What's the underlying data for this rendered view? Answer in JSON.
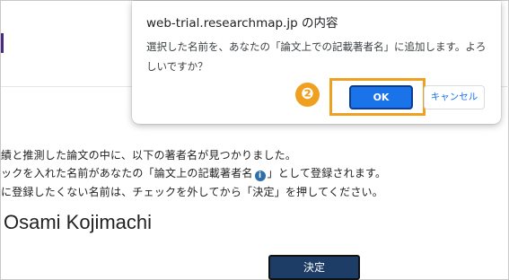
{
  "dialog": {
    "title": "web-trial.researchmap.jp の内容",
    "message": "選択した名前を、あなたの「論文上での記載著者名」に追加します。よろしいですか？",
    "ok_label": "OK",
    "cancel_label": "キャンセル",
    "step_badge": "❷",
    "highlight_color": "#f0a020"
  },
  "page": {
    "line1": "績と推測した論文の中に、以下の著者名が見つかりました。",
    "line2_before": "ックを入れた名前があなたの「論文上の記載著者名",
    "info_icon": "i",
    "line2_after": "」として登録されます。",
    "line3": "に登録したくない名前は、チェックを外してから「決定」を押してください。",
    "author_name": "Osami Kojimachi",
    "decide_label": "決定"
  },
  "colors": {
    "primary_button": "#1a73e8",
    "decide_button": "#1e3d66",
    "accent": "#4b2b7f"
  }
}
